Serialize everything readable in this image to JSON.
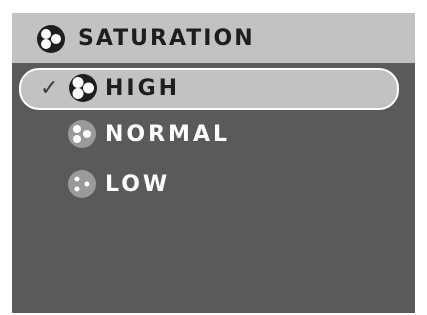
{
  "header": {
    "title": "SATURATION",
    "icon": "saturation-icon"
  },
  "menu": {
    "items": [
      {
        "label": "HIGH",
        "icon": "saturation-high-icon",
        "selected": true,
        "check": "✓"
      },
      {
        "label": "NORMAL",
        "icon": "saturation-normal-icon",
        "selected": false
      },
      {
        "label": "LOW",
        "icon": "saturation-low-icon",
        "selected": false
      }
    ]
  },
  "colors": {
    "background": "#5a5a5a",
    "header": "#c2c2c2",
    "highlight": "#c2c2c2",
    "text_dark": "#1e1e1e",
    "text_light": "#ffffff"
  }
}
